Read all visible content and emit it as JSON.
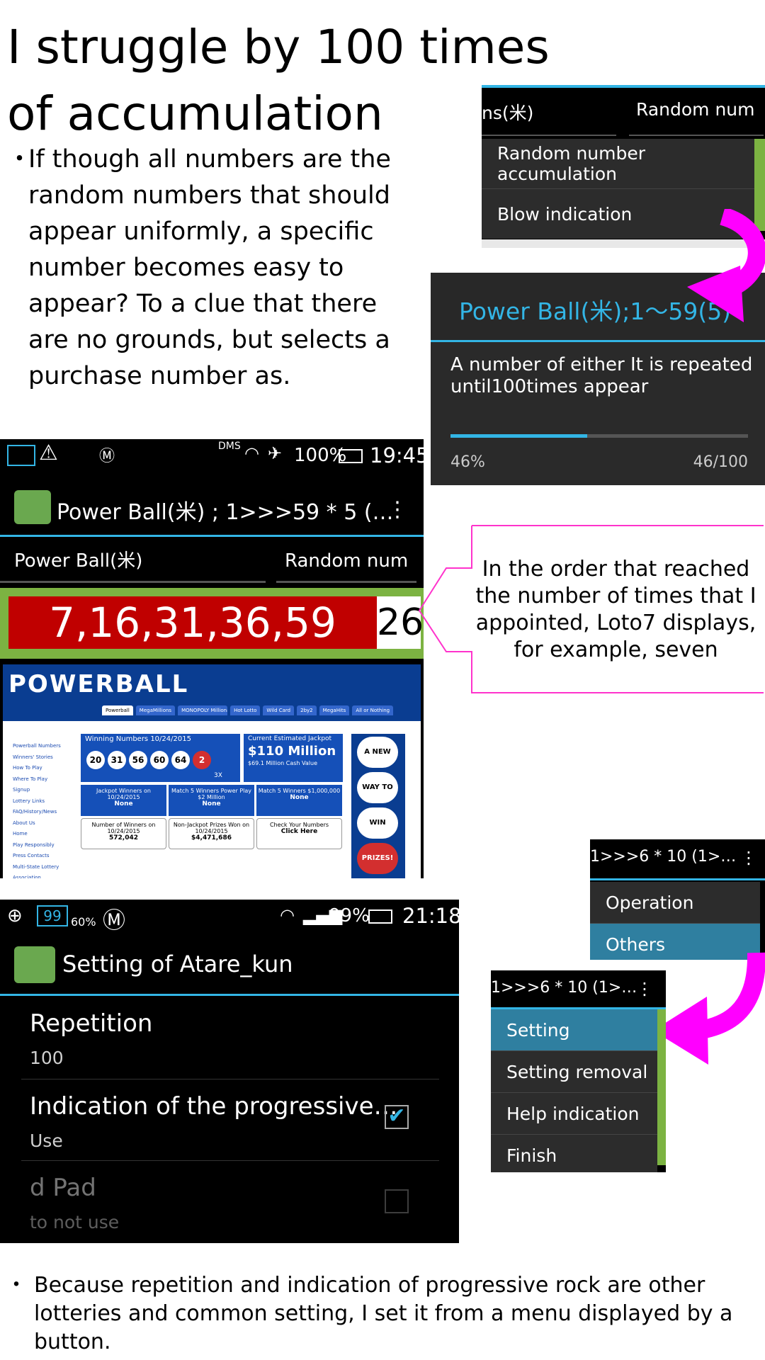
{
  "heading": "I struggle by 100 times of accumulation",
  "intro_bullet": "・",
  "intro_text": "If though all numbers are the random numbers that should appear uniformly, a specific number becomes easy to appear? To a clue that there are no grounds, but selects a purchase number as.",
  "menu1": {
    "left_label": "ns(米)",
    "right_label": "Random num",
    "items": [
      "Random number accumulation",
      "Blow indication"
    ]
  },
  "dialog": {
    "title": "Power Ball(米);1〜59(5)",
    "message": "A number of either It is repeated until100times appear",
    "percent_text": "46%",
    "count_text": "46/100",
    "progress": 0.46
  },
  "main_screen": {
    "status_left": "DMS",
    "status_battery": "100%",
    "status_time": "19:45",
    "title": "Power Ball(米) ; 1>>>59 * 5 (…",
    "spinner_left": "Power Ball(米)",
    "spinner_right": "Random num",
    "result": "7,16,31,36,59",
    "count": "26",
    "web": {
      "logo": "POWERBALL",
      "winning_header": "Winning Numbers 10/24/2015",
      "balls": [
        "20",
        "31",
        "56",
        "60",
        "64",
        "2"
      ],
      "multiplier": "3X",
      "jackpot_header": "Current Estimated Jackpot",
      "jackpot": "$110 Million",
      "cash": "$69.1 Million Cash Value",
      "tabs": [
        "Powerball",
        "MegaMillions",
        "MONOPOLY Millionaires' Club",
        "Hot Lotto",
        "Wild Card",
        "2by2",
        "MegaHits",
        "All or Nothing"
      ],
      "side_links": [
        "Powerball Numbers",
        "Winners' Stories",
        "How To Play",
        "Where To Play",
        "Signup",
        "Lottery Links",
        "FAQ/History/News",
        "About Us",
        "Home",
        "Play Responsibly",
        "Press Contacts",
        "Multi-State Lottery Association"
      ],
      "cells": [
        {
          "t": "Jackpot Winners on 10/24/2015",
          "s": "None"
        },
        {
          "t": "Match 5 Winners Power Play $2 Million",
          "s": "None"
        },
        {
          "t": "Match 5 Winners $1,000,000",
          "s": "None"
        },
        {
          "t": "Number of Winners on 10/24/2015",
          "s": "572,042"
        },
        {
          "t": "Non-Jackpot Prizes Won on 10/24/2015",
          "s": "$4,471,686"
        },
        {
          "t": "Check Your Numbers",
          "s": "Click Here"
        }
      ],
      "promo": [
        "A NEW",
        "WAY TO",
        "WIN",
        "PRIZES!"
      ]
    }
  },
  "callout_text": "In the order that reached the number of times that I appointed, Loto7 displays, for example, seven",
  "menu2": {
    "title": "1>>>6 * 10 (1>…",
    "items": [
      "Operation",
      "Others"
    ]
  },
  "menu3": {
    "title": "1>>>6 * 10 (1>…",
    "items": [
      "Setting",
      "Setting removal",
      "Help indication",
      "Finish"
    ]
  },
  "settings_screen": {
    "status_battery": "99%",
    "status_time": "21:18",
    "status_badge": "99",
    "status_weather": "60%",
    "title": "Setting of Atare_kun",
    "rows": [
      {
        "title": "Repetition",
        "sub": "100"
      },
      {
        "title": "Indication of the progressive…",
        "sub": "Use"
      },
      {
        "title": "d Pad",
        "sub": "to not use"
      }
    ]
  },
  "footer_bullet": "・",
  "footer_text": "Because repetition and indication of progressive rock are other lotteries and common setting, I set it from a menu displayed by a button.",
  "colors": {
    "accent": "#33b5e5",
    "magenta": "#ff00ff",
    "result_bg": "#c00000",
    "frame_green": "#7cb342"
  }
}
